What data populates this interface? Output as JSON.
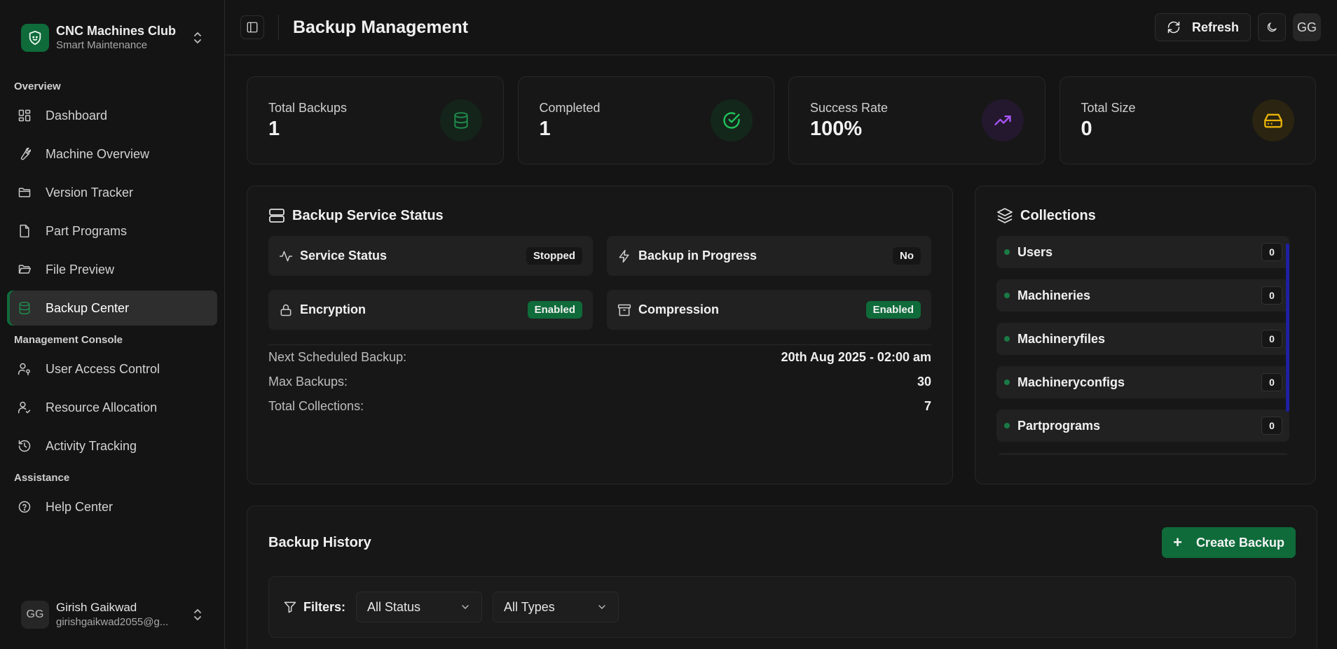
{
  "brand": {
    "title": "CNC Machines Club",
    "subtitle": "Smart Maintenance",
    "accent": "#0f6b3a"
  },
  "sidebar": {
    "groups": [
      {
        "label": "Overview"
      },
      {
        "label": "Management Console"
      },
      {
        "label": "Assistance"
      }
    ],
    "items": [
      {
        "label": "Dashboard",
        "icon": "grid-icon"
      },
      {
        "label": "Machine Overview",
        "icon": "wrench-icon"
      },
      {
        "label": "Version Tracker",
        "icon": "folder-icon"
      },
      {
        "label": "Part Programs",
        "icon": "file-icon"
      },
      {
        "label": "File Preview",
        "icon": "folder-open-icon"
      },
      {
        "label": "Backup Center",
        "icon": "database-icon",
        "active": true
      },
      {
        "label": "User Access Control",
        "icon": "user-key-icon"
      },
      {
        "label": "Resource Allocation",
        "icon": "user-check-icon"
      },
      {
        "label": "Activity Tracking",
        "icon": "history-icon"
      },
      {
        "label": "Help Center",
        "icon": "help-circle-icon"
      }
    ]
  },
  "user": {
    "initials": "GG",
    "name": "Girish Gaikwad",
    "email": "girishgaikwad2055@g..."
  },
  "header": {
    "title": "Backup Management",
    "refresh_label": "Refresh",
    "avatar_initials": "GG"
  },
  "stats": [
    {
      "label": "Total Backups",
      "value": "1",
      "icon": "database-icon",
      "color": "#1e8a4c"
    },
    {
      "label": "Completed",
      "value": "1",
      "icon": "check-circle-icon",
      "color": "#22c55e"
    },
    {
      "label": "Success Rate",
      "value": "100%",
      "icon": "trending-up-icon",
      "color": "#a855f7"
    },
    {
      "label": "Total Size",
      "value": "0",
      "icon": "hard-drive-icon",
      "color": "#eab308"
    }
  ],
  "service": {
    "title": "Backup Service Status",
    "tiles": [
      {
        "label": "Service Status",
        "value": "Stopped",
        "icon": "activity-icon"
      },
      {
        "label": "Backup in Progress",
        "value": "No",
        "icon": "zap-icon"
      },
      {
        "label": "Encryption",
        "value": "Enabled",
        "icon": "lock-icon"
      },
      {
        "label": "Compression",
        "value": "Enabled",
        "icon": "archive-icon"
      }
    ],
    "details": [
      {
        "key": "Next Scheduled Backup:",
        "value": "20th Aug 2025 - 02:00 am"
      },
      {
        "key": "Max Backups:",
        "value": "30"
      },
      {
        "key": "Total Collections:",
        "value": "7"
      }
    ]
  },
  "collections": {
    "title": "Collections",
    "items": [
      {
        "name": "Users",
        "count": "0"
      },
      {
        "name": "Machineries",
        "count": "0"
      },
      {
        "name": "Machineryfiles",
        "count": "0"
      },
      {
        "name": "Machineryconfigs",
        "count": "0"
      },
      {
        "name": "Partprograms",
        "count": "0"
      }
    ]
  },
  "history": {
    "title": "Backup History",
    "create_label": "Create Backup",
    "filters_label": "Filters:",
    "status_select": "All Status",
    "type_select": "All Types"
  }
}
